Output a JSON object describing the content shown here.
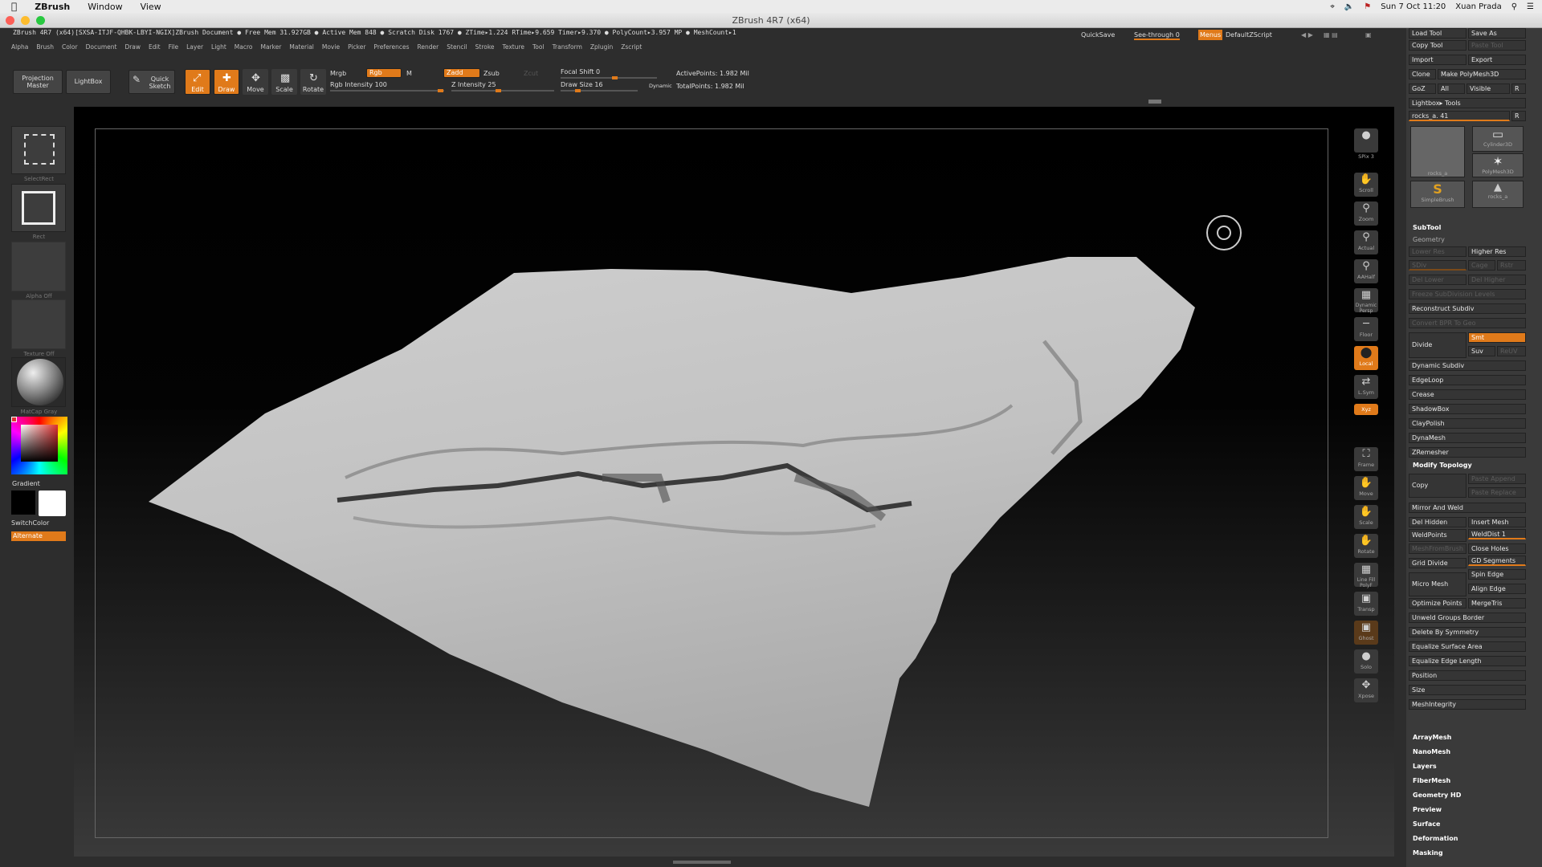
{
  "macbar": {
    "apple": "",
    "app": "ZBrush",
    "menus": [
      "Window",
      "View"
    ],
    "date": "Sun 7 Oct  11:20",
    "user": "Xuan Prada"
  },
  "window": {
    "title": "ZBrush 4R7 (x64)"
  },
  "info": {
    "text": "ZBrush 4R7 (x64)[SXSA-ITJF-QHBK-LBYI-NGIX]ZBrush Document   ● Free Mem 31.927GB ● Active Mem 848 ● Scratch Disk 1767 ●  ZTime▸1.224 RTime▸9.659 Timer▸9.370 ● PolyCount▸3.957  MP  ● MeshCount▸1"
  },
  "menus": [
    "Alpha",
    "Brush",
    "Color",
    "Document",
    "Draw",
    "Edit",
    "File",
    "Layer",
    "Light",
    "Macro",
    "Marker",
    "Material",
    "Movie",
    "Picker",
    "Preferences",
    "Render",
    "Stencil",
    "Stroke",
    "Texture",
    "Tool",
    "Transform",
    "Zplugin",
    "Zscript"
  ],
  "quick": {
    "quicksave": "QuickSave",
    "seethrough": "See-through  0",
    "menus": "Menus",
    "defaultzscript": "DefaultZScript"
  },
  "toolbar": {
    "projection": "Projection Master",
    "lightbox": "LightBox",
    "quicksketch": "Quick Sketch",
    "edit": "Edit",
    "draw": "Draw",
    "move": "Move",
    "scale": "Scale",
    "rotate": "Rotate",
    "mrgb": "Mrgb",
    "rgb": "Rgb",
    "m": "M",
    "rgb_intensity": "Rgb Intensity 100",
    "zadd": "Zadd",
    "zsub": "Zsub",
    "zcut": "Zcut",
    "z_intensity": "Z Intensity 25",
    "focal": "Focal Shift 0",
    "drawsize": "Draw Size 16",
    "dynamic": "Dynamic",
    "activepoints": "ActivePoints: 1.982  Mil",
    "totalpoints": "TotalPoints: 1.982  Mil"
  },
  "leftshelf": {
    "selectrect": "SelectRect",
    "rect": "Rect",
    "alpha": "Alpha Off",
    "texture": "Texture Off",
    "matcap": "MatCap Gray",
    "gradient": "Gradient",
    "switchcolor": "SwitchColor",
    "alternate": "Alternate"
  },
  "rightshelf": [
    "SPix 3",
    "Scroll",
    "Zoom",
    "Actual",
    "AAHalf",
    "Dynamic Persp",
    "Floor",
    "Local",
    "L.Sym",
    "Xyz",
    "Frame",
    "Move",
    "Scale",
    "Rotate",
    "Line Fill PolyF",
    "Transp",
    "Ghost",
    "Solo",
    "Xpose"
  ],
  "tray": {
    "loadtool": "Load Tool",
    "saveas": "Save As",
    "copytool": "Copy Tool",
    "pastetool": "Paste Tool",
    "import": "Import",
    "export": "Export",
    "clone": "Clone",
    "makepolymesh": "Make PolyMesh3D",
    "goz": "GoZ",
    "all": "All",
    "visible": "Visible",
    "r": "R",
    "lightboxtools": "Lightbox▸ Tools",
    "toolname": "rocks_a. 41",
    "r2": "R",
    "thumbs": [
      "rocks_a",
      "Cylinder3D",
      "PolyMesh3D",
      "SimpleBrush",
      "rocks_a"
    ],
    "subtool": "SubTool",
    "geometry": "Geometry",
    "lowerres": "Lower Res",
    "higherres": "Higher Res",
    "sdiv": "SDiv",
    "cage": "Cage",
    "rstr": "Rstr",
    "dellower": "Del Lower",
    "delhigher": "Del Higher",
    "freeze": "Freeze SubDivision Levels",
    "reconstruct": "Reconstruct Subdiv",
    "convertbpr": "Convert BPR To Geo",
    "divide": "Divide",
    "smt": "Smt",
    "suv": "Suv",
    "reuv": "ReUV",
    "dynsubdiv": "Dynamic Subdiv",
    "edgeloop": "EdgeLoop",
    "crease": "Crease",
    "shadowbox": "ShadowBox",
    "claypolish": "ClayPolish",
    "dynamesh": "DynaMesh",
    "zremesher": "ZRemesher",
    "modifytopo": "Modify Topology",
    "copy": "Copy",
    "pasteappend": "Paste Append",
    "pastereplace": "Paste Replace",
    "mirrorweld": "Mirror And Weld",
    "delhidden": "Del Hidden",
    "insertmesh": "Insert Mesh",
    "weldpoints": "WeldPoints",
    "welddist": "WeldDist 1",
    "meshfrombrush": "MeshFromBrush",
    "closeholes": "Close Holes",
    "griddivide": "Grid Divide",
    "gdsegments": "GD Segments",
    "spinedge": "Spin Edge",
    "micromesh": "Micro Mesh",
    "alignedge": "Align Edge",
    "optimize": "Optimize Points",
    "mergetris": "MergeTris",
    "unweld": "Unweld Groups Border",
    "delsym": "Delete By Symmetry",
    "eqsurface": "Equalize Surface Area",
    "eqedge": "Equalize Edge Length",
    "position": "Position",
    "size": "Size",
    "meshintegrity": "MeshIntegrity",
    "sections": [
      "ArrayMesh",
      "NanoMesh",
      "Layers",
      "FiberMesh",
      "Geometry HD",
      "Preview",
      "Surface",
      "Deformation",
      "Masking"
    ]
  },
  "colors": {
    "accent": "#e07a1a"
  }
}
